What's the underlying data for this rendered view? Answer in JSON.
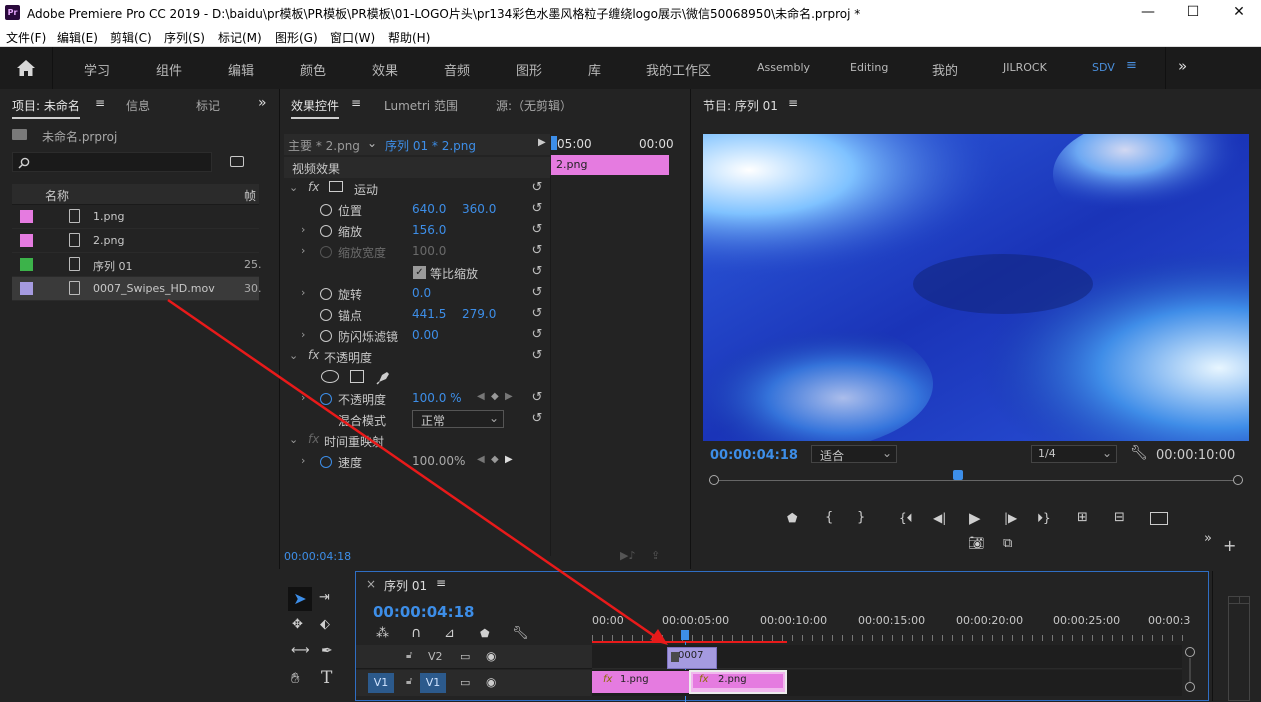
{
  "window": {
    "app_title": "Adobe Premiere Pro CC 2019 - D:\\baidu\\pr模板\\PR模板\\PR模板\\01-LOGO片头\\pr134彩色水墨风格粒子缠绕logo展示\\微信50068950\\未命名.prproj *",
    "minimize": "—",
    "maximize": "☐",
    "close": "✕"
  },
  "menu": [
    "文件(F)",
    "编辑(E)",
    "剪辑(C)",
    "序列(S)",
    "标记(M)",
    "图形(G)",
    "窗口(W)",
    "帮助(H)"
  ],
  "workspaces": [
    "学习",
    "组件",
    "编辑",
    "颜色",
    "效果",
    "音频",
    "图形",
    "库",
    "我的工作区",
    "Assembly",
    "Editing",
    "我的",
    "JILROCK",
    "SDV"
  ],
  "workspace_more": "»",
  "project": {
    "tab_project": "项目: 未命名",
    "tab_info": "信息",
    "tab_markers": "标记",
    "more": "»",
    "file_name": "未命名.prproj",
    "search_placeholder": "",
    "col_name": "名称",
    "col_rate": "帧",
    "items": [
      {
        "name": "1.png",
        "rate": "",
        "color": "#e57be0"
      },
      {
        "name": "2.png",
        "rate": "",
        "color": "#e57be0"
      },
      {
        "name": "序列 01",
        "rate": "25.",
        "color": "#3cb34a"
      },
      {
        "name": "0007_Swipes_HD.mov",
        "rate": "30.",
        "color": "#a59ae0"
      }
    ]
  },
  "effects": {
    "tab_controls": "效果控件",
    "tab_lumetri": "Lumetri 范围",
    "tab_source": "源:（无剪辑）",
    "master": "主要 * 2.png",
    "sequence": "序列 01 * 2.png",
    "time_start": ":05:00",
    "time_end": "00:00",
    "clip_label": "2.png",
    "video_effects": "视频效果",
    "motion": "运动",
    "position_label": "位置",
    "position_x": "640.0",
    "position_y": "360.0",
    "scale_label": "缩放",
    "scale_value": "156.0",
    "scale_width_label": "缩放宽度",
    "scale_width_value": "100.0",
    "uniform_scale": "等比缩放",
    "rotation_label": "旋转",
    "rotation_value": "0.0",
    "anchor_label": "锚点",
    "anchor_x": "441.5",
    "anchor_y": "279.0",
    "flicker_label": "防闪烁滤镜",
    "flicker_value": "0.00",
    "opacity": "不透明度",
    "opacity_label": "不透明度",
    "opacity_value": "100.0 %",
    "blend_label": "混合模式",
    "blend_value": "正常",
    "time_remap": "时间重映射",
    "speed_label": "速度",
    "speed_value": "100.00%",
    "timecode": "00:00:04:18"
  },
  "program": {
    "title": "节目: 序列 01",
    "timecode": "00:00:04:18",
    "fit": "适合",
    "resolution": "1/4",
    "duration": "00:00:10:00",
    "playhead_fraction": 0.465
  },
  "timeline": {
    "tab_close": "×",
    "tab_title": "序列 01",
    "timecode": "00:00:04:18",
    "ruler": [
      "00:00",
      "00:00:05:00",
      "00:00:10:00",
      "00:00:15:00",
      "00:00:20:00",
      "00:00:25:00",
      "00:00:3"
    ],
    "track_v2": "V2",
    "track_v1": "V1",
    "source_v1": "V1",
    "clip_v2": "0007",
    "clip_v1a": "1.png",
    "clip_v1b": "2.png",
    "fx": "fx"
  },
  "colors": {
    "accent": "#3d8ee8",
    "clip_pink": "#e57be0",
    "clip_purple": "#a59ae0",
    "annotation_arrow": "#e81a1a"
  }
}
